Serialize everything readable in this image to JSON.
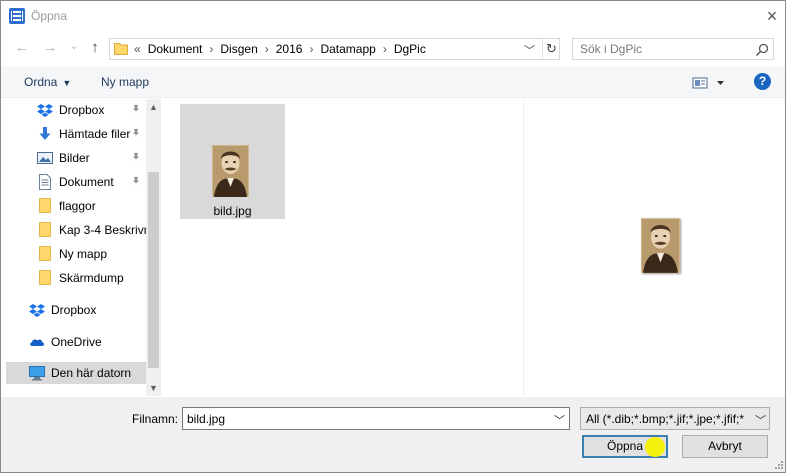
{
  "window": {
    "title": "Öppna",
    "close_label": "×"
  },
  "nav": {
    "back_label": "←",
    "forward_label": "→",
    "recent_label": "⌄",
    "up_label": "↑",
    "breadcrumb_prefix": "«",
    "breadcrumbs": [
      "Dokument",
      "Disgen",
      "2016",
      "Datamapp",
      "DgPic"
    ],
    "separator": "›",
    "refresh_label": "↻",
    "search_placeholder": "Sök i DgPic"
  },
  "toolbar": {
    "organize_label": "Ordna",
    "organize_caret": "▼",
    "new_folder_label": "Ny mapp",
    "help_label": "?"
  },
  "sidebar": {
    "items": [
      {
        "label": "Dropbox",
        "icon": "dropbox-icon",
        "pinned": true
      },
      {
        "label": "Hämtade filer",
        "icon": "download-icon",
        "pinned": true
      },
      {
        "label": "Bilder",
        "icon": "pictures-icon",
        "pinned": true
      },
      {
        "label": "Dokument",
        "icon": "documents-icon",
        "pinned": true
      },
      {
        "label": "flaggor",
        "icon": "folder-icon",
        "pinned": false
      },
      {
        "label": "Kap 3-4 Beskrivn",
        "icon": "folder-icon",
        "pinned": false
      },
      {
        "label": "Ny mapp",
        "icon": "folder-icon",
        "pinned": false
      },
      {
        "label": "Skärmdump",
        "icon": "folder-icon",
        "pinned": false
      },
      {
        "label": "Dropbox",
        "icon": "dropbox-icon",
        "pinned": false
      },
      {
        "label": "OneDrive",
        "icon": "onedrive-icon",
        "pinned": false
      },
      {
        "label": "Den här datorn",
        "icon": "computer-icon",
        "pinned": false,
        "selected": true
      }
    ],
    "pin_glyph": "📌"
  },
  "files": [
    {
      "name": "bild.jpg",
      "selected": true,
      "icon": "photo-thumbnail-icon"
    }
  ],
  "footer": {
    "filename_label": "Filnamn:",
    "filename_value": "bild.jpg",
    "filter_value": "All (*.dib;*.bmp;*.jif;*.jpe;*.jfif;*",
    "open_label": "Öppna",
    "cancel_label": "Avbryt"
  },
  "colors": {
    "accent": "#1a65c0",
    "selection": "#d9d9d9",
    "folder": "#ffd76b",
    "cursor_highlight": "#f5f000"
  }
}
